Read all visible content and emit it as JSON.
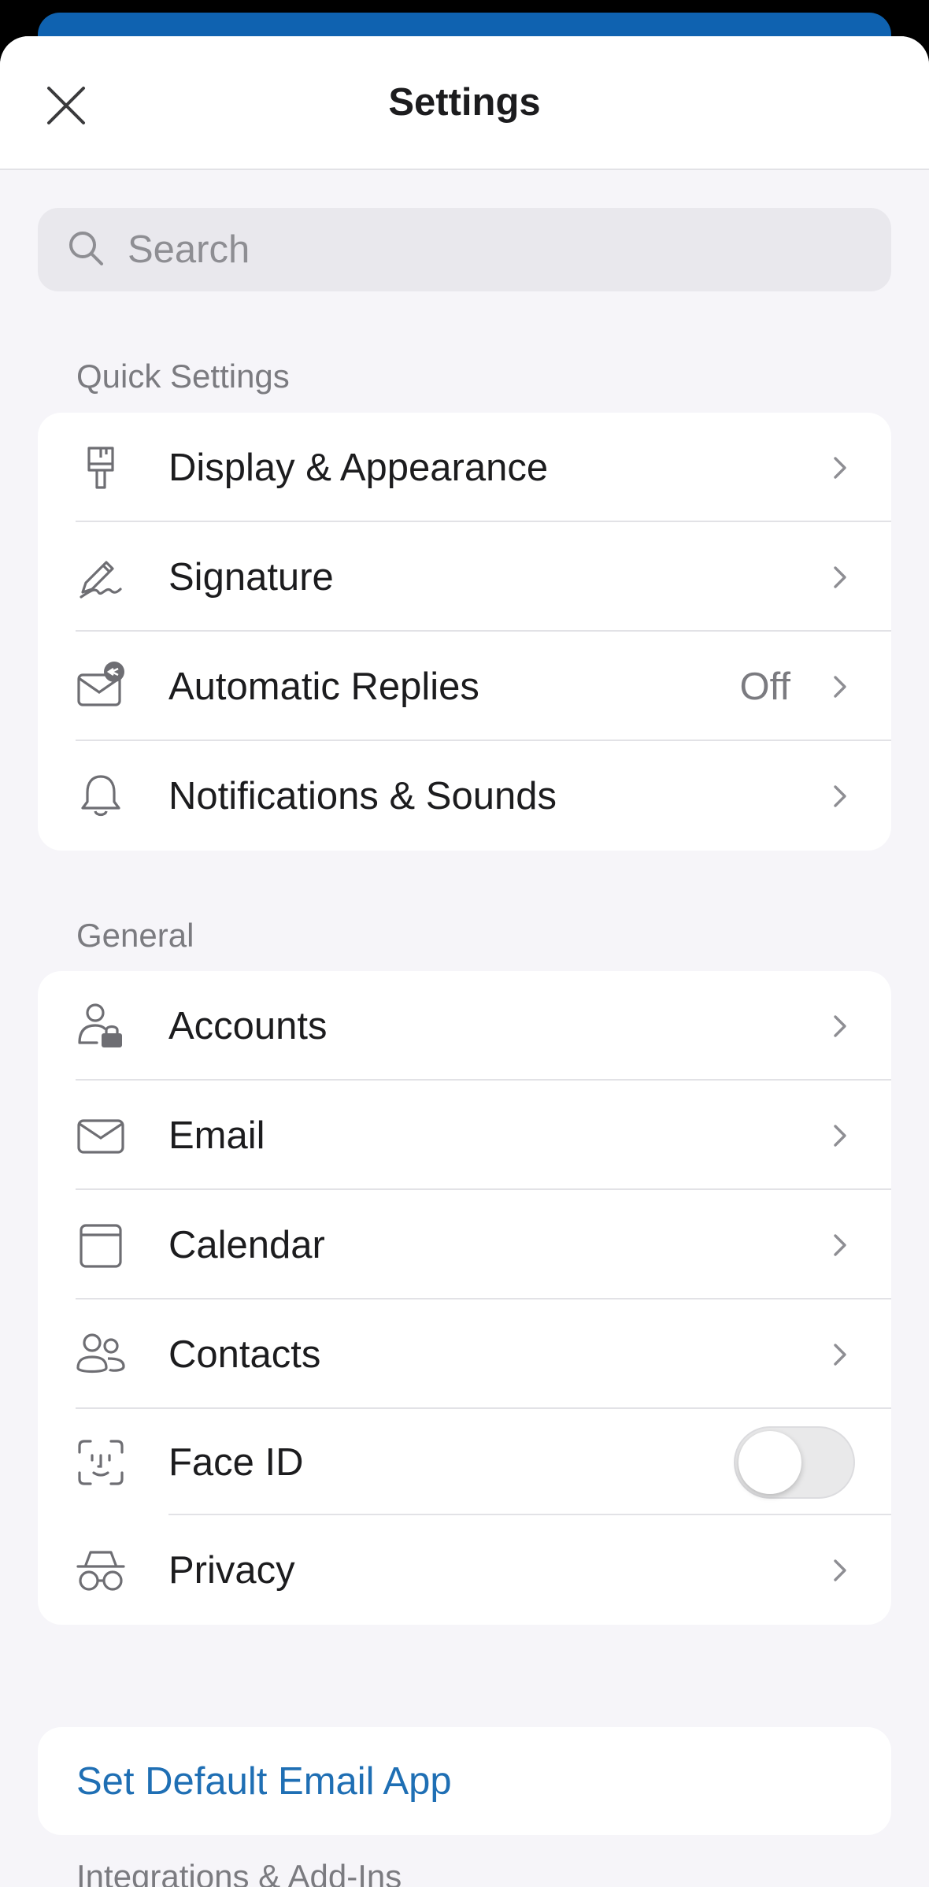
{
  "header": {
    "title": "Settings",
    "close_icon": "close-icon"
  },
  "search": {
    "placeholder": "Search",
    "icon": "search-icon"
  },
  "quick_settings": {
    "label": "Quick Settings",
    "items": [
      {
        "label": "Display & Appearance",
        "icon": "paintbrush-icon",
        "value": ""
      },
      {
        "label": "Signature",
        "icon": "signature-pen-icon",
        "value": ""
      },
      {
        "label": "Automatic Replies",
        "icon": "mail-auto-reply-icon",
        "value": "Off"
      },
      {
        "label": "Notifications & Sounds",
        "icon": "bell-icon",
        "value": ""
      }
    ]
  },
  "general": {
    "label": "General",
    "items": [
      {
        "label": "Accounts",
        "icon": "person-lock-icon"
      },
      {
        "label": "Email",
        "icon": "envelope-icon"
      },
      {
        "label": "Calendar",
        "icon": "calendar-icon"
      },
      {
        "label": "Contacts",
        "icon": "contacts-icon"
      },
      {
        "label": "Face ID",
        "icon": "face-id-icon",
        "toggle_on": false
      },
      {
        "label": "Privacy",
        "icon": "incognito-icon"
      }
    ]
  },
  "default_app": {
    "label": "Set Default Email App"
  },
  "integrations": {
    "label": "Integrations & Add-Ins"
  },
  "colors": {
    "accent_link": "#1f6fb4",
    "header_strip": "#0f62b0",
    "background": "#f6f5f9"
  }
}
